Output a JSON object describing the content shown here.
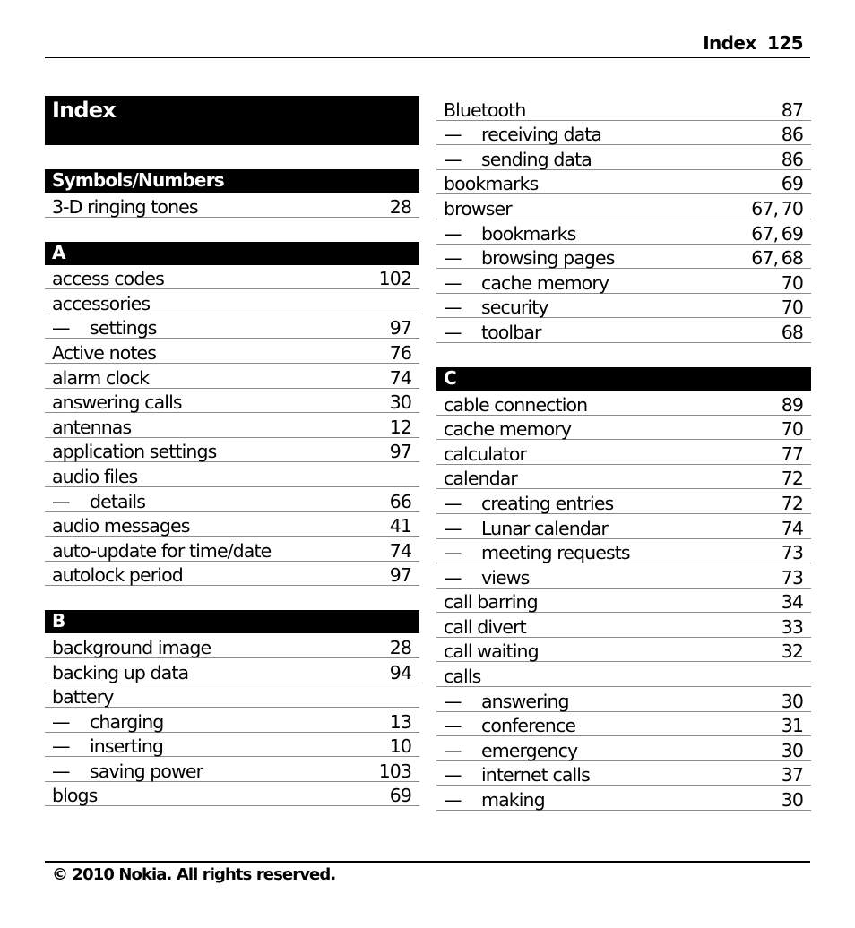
{
  "header": {
    "section": "Index",
    "page_number": "125"
  },
  "title": "Index",
  "dash": "—",
  "left_column": [
    {
      "type": "letter",
      "label": "Symbols/Numbers"
    },
    {
      "type": "entry",
      "term": "3-D ringing tones",
      "pages": "28",
      "sub": false
    },
    {
      "type": "gap"
    },
    {
      "type": "letter",
      "label": "A"
    },
    {
      "type": "entry",
      "term": "access codes",
      "pages": "102",
      "sub": false
    },
    {
      "type": "entry",
      "term": "accessories",
      "pages": "",
      "sub": false
    },
    {
      "type": "entry",
      "term": "settings",
      "pages": "97",
      "sub": true
    },
    {
      "type": "entry",
      "term": "Active notes",
      "pages": "76",
      "sub": false
    },
    {
      "type": "entry",
      "term": "alarm clock",
      "pages": "74",
      "sub": false
    },
    {
      "type": "entry",
      "term": "answering calls",
      "pages": "30",
      "sub": false
    },
    {
      "type": "entry",
      "term": "antennas",
      "pages": "12",
      "sub": false
    },
    {
      "type": "entry",
      "term": "application settings",
      "pages": "97",
      "sub": false
    },
    {
      "type": "entry",
      "term": "audio files",
      "pages": "",
      "sub": false
    },
    {
      "type": "entry",
      "term": "details",
      "pages": "66",
      "sub": true
    },
    {
      "type": "entry",
      "term": "audio messages",
      "pages": "41",
      "sub": false
    },
    {
      "type": "entry",
      "term": "auto-update for time/date",
      "pages": "74",
      "sub": false
    },
    {
      "type": "entry",
      "term": "autolock period",
      "pages": "97",
      "sub": false
    },
    {
      "type": "gap"
    },
    {
      "type": "letter",
      "label": "B"
    },
    {
      "type": "entry",
      "term": "background image",
      "pages": "28",
      "sub": false
    },
    {
      "type": "entry",
      "term": "backing up data",
      "pages": "94",
      "sub": false
    },
    {
      "type": "entry",
      "term": "battery",
      "pages": "",
      "sub": false
    },
    {
      "type": "entry",
      "term": "charging",
      "pages": "13",
      "sub": true
    },
    {
      "type": "entry",
      "term": "inserting",
      "pages": "10",
      "sub": true
    },
    {
      "type": "entry",
      "term": "saving power",
      "pages": "103",
      "sub": true
    },
    {
      "type": "entry",
      "term": "blogs",
      "pages": "69",
      "sub": false
    }
  ],
  "right_column": [
    {
      "type": "entry",
      "term": "Bluetooth",
      "pages": "87",
      "sub": false
    },
    {
      "type": "entry",
      "term": "receiving data",
      "pages": "86",
      "sub": true
    },
    {
      "type": "entry",
      "term": "sending data",
      "pages": "86",
      "sub": true
    },
    {
      "type": "entry",
      "term": "bookmarks",
      "pages": "69",
      "sub": false
    },
    {
      "type": "entry",
      "term": "browser",
      "pages": "67, 70",
      "sub": false
    },
    {
      "type": "entry",
      "term": "bookmarks",
      "pages": "67, 69",
      "sub": true
    },
    {
      "type": "entry",
      "term": "browsing pages",
      "pages": "67, 68",
      "sub": true
    },
    {
      "type": "entry",
      "term": "cache memory",
      "pages": "70",
      "sub": true
    },
    {
      "type": "entry",
      "term": "security",
      "pages": "70",
      "sub": true
    },
    {
      "type": "entry",
      "term": "toolbar",
      "pages": "68",
      "sub": true
    },
    {
      "type": "gap"
    },
    {
      "type": "letter",
      "label": "C"
    },
    {
      "type": "entry",
      "term": "cable connection",
      "pages": "89",
      "sub": false
    },
    {
      "type": "entry",
      "term": "cache memory",
      "pages": "70",
      "sub": false
    },
    {
      "type": "entry",
      "term": "calculator",
      "pages": "77",
      "sub": false
    },
    {
      "type": "entry",
      "term": "calendar",
      "pages": "72",
      "sub": false
    },
    {
      "type": "entry",
      "term": "creating entries",
      "pages": "72",
      "sub": true
    },
    {
      "type": "entry",
      "term": "Lunar calendar",
      "pages": "74",
      "sub": true
    },
    {
      "type": "entry",
      "term": "meeting requests",
      "pages": "73",
      "sub": true
    },
    {
      "type": "entry",
      "term": "views",
      "pages": "73",
      "sub": true
    },
    {
      "type": "entry",
      "term": "call barring",
      "pages": "34",
      "sub": false
    },
    {
      "type": "entry",
      "term": "call divert",
      "pages": "33",
      "sub": false
    },
    {
      "type": "entry",
      "term": "call waiting",
      "pages": "32",
      "sub": false
    },
    {
      "type": "entry",
      "term": "calls",
      "pages": "",
      "sub": false
    },
    {
      "type": "entry",
      "term": "answering",
      "pages": "30",
      "sub": true
    },
    {
      "type": "entry",
      "term": "conference",
      "pages": "31",
      "sub": true
    },
    {
      "type": "entry",
      "term": "emergency",
      "pages": "30",
      "sub": true
    },
    {
      "type": "entry",
      "term": "internet calls",
      "pages": "37",
      "sub": true
    },
    {
      "type": "entry",
      "term": "making",
      "pages": "30",
      "sub": true
    }
  ],
  "footer": {
    "copyright": "© 2010 Nokia. All rights reserved."
  }
}
